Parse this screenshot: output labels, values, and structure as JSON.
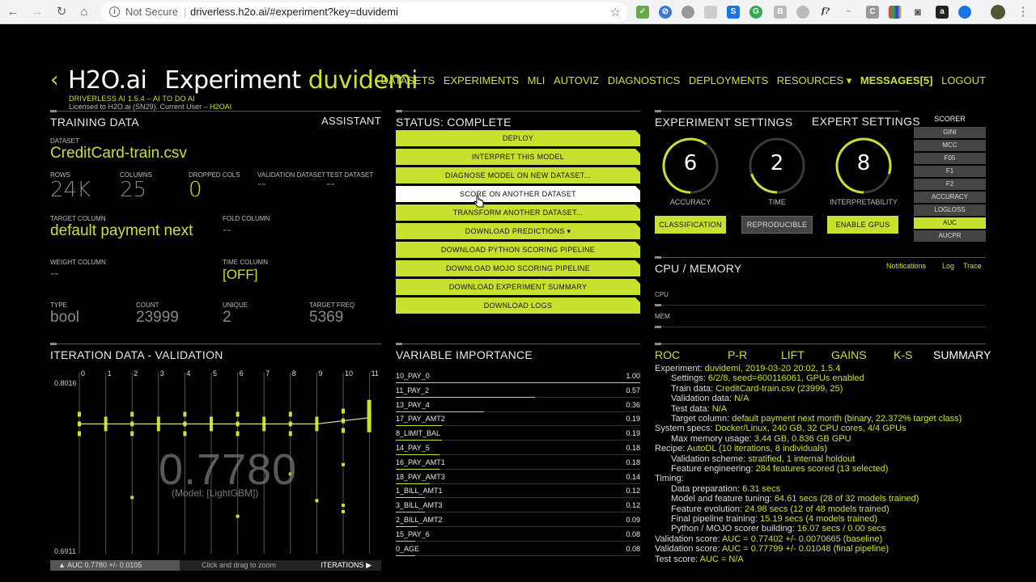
{
  "browser": {
    "security": "Not Secure",
    "url": "driverless.h2o.ai/#experiment?key=duvidemi"
  },
  "header": {
    "brand": "H2O.ai",
    "experiment_label": "Experiment",
    "experiment_name": "duvidemi",
    "version_line": "DRIVERLESS AI 1.5.4",
    "tagline": " – AI TO DO AI",
    "license_line_prefix": "Licensed to H2O.ai (SN29). Current User – ",
    "current_user": "H2OAI"
  },
  "nav": [
    "DATASETS",
    "EXPERIMENTS",
    "MLI",
    "AUTOVIZ",
    "DIAGNOSTICS",
    "DEPLOYMENTS",
    "RESOURCES ▾",
    "MESSAGES[5]",
    "LOGOUT"
  ],
  "training": {
    "title": "TRAINING DATA",
    "assistant": "ASSISTANT",
    "dataset_label": "DATASET",
    "dataset": "CreditCard-train.csv",
    "rows_label": "ROWS",
    "rows": "24K",
    "columns_label": "COLUMNS",
    "columns": "25",
    "dropped_label": "DROPPED COLS",
    "dropped": "0",
    "validation_label": "VALIDATION DATASET",
    "validation": "--",
    "test_label": "TEST DATASET",
    "test": "--",
    "target_label": "TARGET COLUMN",
    "target": "default payment next",
    "fold_label": "FOLD COLUMN",
    "fold": "--",
    "weight_label": "WEIGHT COLUMN",
    "weight": "--",
    "time_label": "TIME COLUMN",
    "time": "[OFF]",
    "type_label": "TYPE",
    "type": "bool",
    "count_label": "COUNT",
    "count": "23999",
    "unique_label": "UNIQUE",
    "unique": "2",
    "freq_label": "TARGET FREQ",
    "freq": "5369"
  },
  "status": {
    "title": "STATUS: COMPLETE",
    "buttons": [
      "DEPLOY",
      "INTERPRET THIS MODEL",
      "DIAGNOSE MODEL ON NEW DATASET...",
      "SCORE ON ANOTHER DATASET",
      "TRANSFORM ANOTHER DATASET...",
      "DOWNLOAD PREDICTIONS ▾",
      "DOWNLOAD PYTHON SCORING PIPELINE",
      "DOWNLOAD MOJO SCORING PIPELINE",
      "DOWNLOAD EXPERIMENT SUMMARY",
      "DOWNLOAD LOGS"
    ]
  },
  "settings": {
    "title": "EXPERIMENT SETTINGS",
    "expert": "EXPERT SETTINGS",
    "accuracy": "6",
    "accuracy_label": "ACCURACY",
    "accuracy_level": 0.6,
    "time": "2",
    "time_label": "TIME",
    "time_level": 0.2,
    "interp": "8",
    "interp_label": "INTERPRETABILITY",
    "interp_level": 0.8,
    "btn_classification": "CLASSIFICATION",
    "btn_reproducible": "REPRODUCIBLE",
    "btn_gpus": "ENABLE GPUS",
    "scorer_title": "SCORER",
    "scorers": [
      "GINI",
      "MCC",
      "F05",
      "F1",
      "F2",
      "ACCURACY",
      "LOGLOSS",
      "AUC",
      "AUCPR"
    ],
    "selected_scorer": "AUC"
  },
  "cpu": {
    "title": "CPU / MEMORY",
    "links": [
      "Notifications",
      "Log",
      "Trace"
    ],
    "cpu_label": "CPU",
    "mem_label": "MEM"
  },
  "iteration": {
    "title": "ITERATION DATA - VALIDATION",
    "ticks": [
      "0",
      "1",
      "2",
      "3",
      "4",
      "5",
      "6",
      "7",
      "8",
      "9",
      "10",
      "11"
    ],
    "ymax": "0.8016",
    "ymin": "0.6911",
    "score": "0.7780",
    "model": "(Model: [LightGBM])",
    "auc_text": "AUC 0.7780 +/- 0.0105",
    "zoom_text": "Click and drag to zoom",
    "iterations_label": "ITERATIONS",
    "line_values": [
      0.774,
      0.774,
      0.774,
      0.774,
      0.774,
      0.774,
      0.774,
      0.774,
      0.774,
      0.774,
      0.776,
      0.778
    ]
  },
  "varimp": {
    "title": "VARIABLE IMPORTANCE",
    "rows": [
      {
        "name": "10_PAY_0",
        "value": "1.00",
        "frac": 1.0
      },
      {
        "name": "11_PAY_2",
        "value": "0.57",
        "frac": 0.57
      },
      {
        "name": "13_PAY_4",
        "value": "0.36",
        "frac": 0.36
      },
      {
        "name": "17_PAY_AMT2",
        "value": "0.19",
        "frac": 0.19
      },
      {
        "name": "8_LIMIT_BAL",
        "value": "0.19",
        "frac": 0.19
      },
      {
        "name": "14_PAY_5",
        "value": "0.18",
        "frac": 0.18
      },
      {
        "name": "16_PAY_AMT1",
        "value": "0.18",
        "frac": 0.18
      },
      {
        "name": "18_PAY_AMT3",
        "value": "0.14",
        "frac": 0.14
      },
      {
        "name": "1_BILL_AMT1",
        "value": "0.12",
        "frac": 0.12
      },
      {
        "name": "3_BILL_AMT3",
        "value": "0.12",
        "frac": 0.12
      },
      {
        "name": "2_BILL_AMT2",
        "value": "0.09",
        "frac": 0.09
      },
      {
        "name": "15_PAY_6",
        "value": "0.08",
        "frac": 0.08
      },
      {
        "name": "0_AGE",
        "value": "0.08",
        "frac": 0.08
      }
    ]
  },
  "summary": {
    "tabs": [
      "ROC",
      "P-R",
      "LIFT",
      "GAINS",
      "K-S",
      "SUMMARY"
    ],
    "lines": [
      {
        "k": "Experiment: ",
        "v": "duvidemi, 2019-03-20 20:02, 1.5.4",
        "indent": 0
      },
      {
        "k": "Settings: ",
        "v": "6/2/8, seed=600116061, GPUs enabled",
        "indent": 1
      },
      {
        "k": "Train data: ",
        "v": "CreditCard-train.csv (23999, 25)",
        "indent": 1
      },
      {
        "k": "Validation data: ",
        "v": "N/A",
        "indent": 1
      },
      {
        "k": "Test data: ",
        "v": "N/A",
        "indent": 1
      },
      {
        "k": "Target column: ",
        "v": "default payment next month (binary, 22.372% target class)",
        "indent": 1
      },
      {
        "k": "System specs: ",
        "v": "Docker/Linux, 240 GB, 32 CPU cores, 4/4 GPUs",
        "indent": 0
      },
      {
        "k": "Max memory usage: ",
        "v": "3.44 GB, 0.836 GB GPU",
        "indent": 1
      },
      {
        "k": "Recipe: ",
        "v": "AutoDL (10 iterations, 8 individuals)",
        "indent": 0
      },
      {
        "k": "Validation scheme: ",
        "v": "stratified, 1 internal holdout",
        "indent": 1
      },
      {
        "k": "Feature engineering: ",
        "v": "284 features scored (13 selected)",
        "indent": 1
      },
      {
        "k": "Timing:",
        "v": "",
        "indent": 0
      },
      {
        "k": "Data preparation: ",
        "v": "6.31 secs",
        "indent": 1
      },
      {
        "k": "Model and feature tuning: ",
        "v": "64.61 secs (28 of 32 models trained)",
        "indent": 1
      },
      {
        "k": "Feature evolution: ",
        "v": "24.98 secs (12 of 48 models trained)",
        "indent": 1
      },
      {
        "k": "Final pipeline training: ",
        "v": "15.19 secs (4 models trained)",
        "indent": 1
      },
      {
        "k": "Python / MOJO scorer building: ",
        "v": "16.07 secs / 0.00 secs",
        "indent": 1
      },
      {
        "k": "Validation score: ",
        "v": "AUC = 0.77402 +/- 0.0070665 (baseline)",
        "indent": 0
      },
      {
        "k": "Validation score: ",
        "v": "AUC = 0.77799 +/- 0.01048 (final pipeline)",
        "indent": 0
      },
      {
        "k": "Test score: ",
        "v": "AUC = N/A",
        "indent": 0
      }
    ]
  },
  "colors": {
    "accent": "#c9e12e",
    "background": "#000000"
  }
}
